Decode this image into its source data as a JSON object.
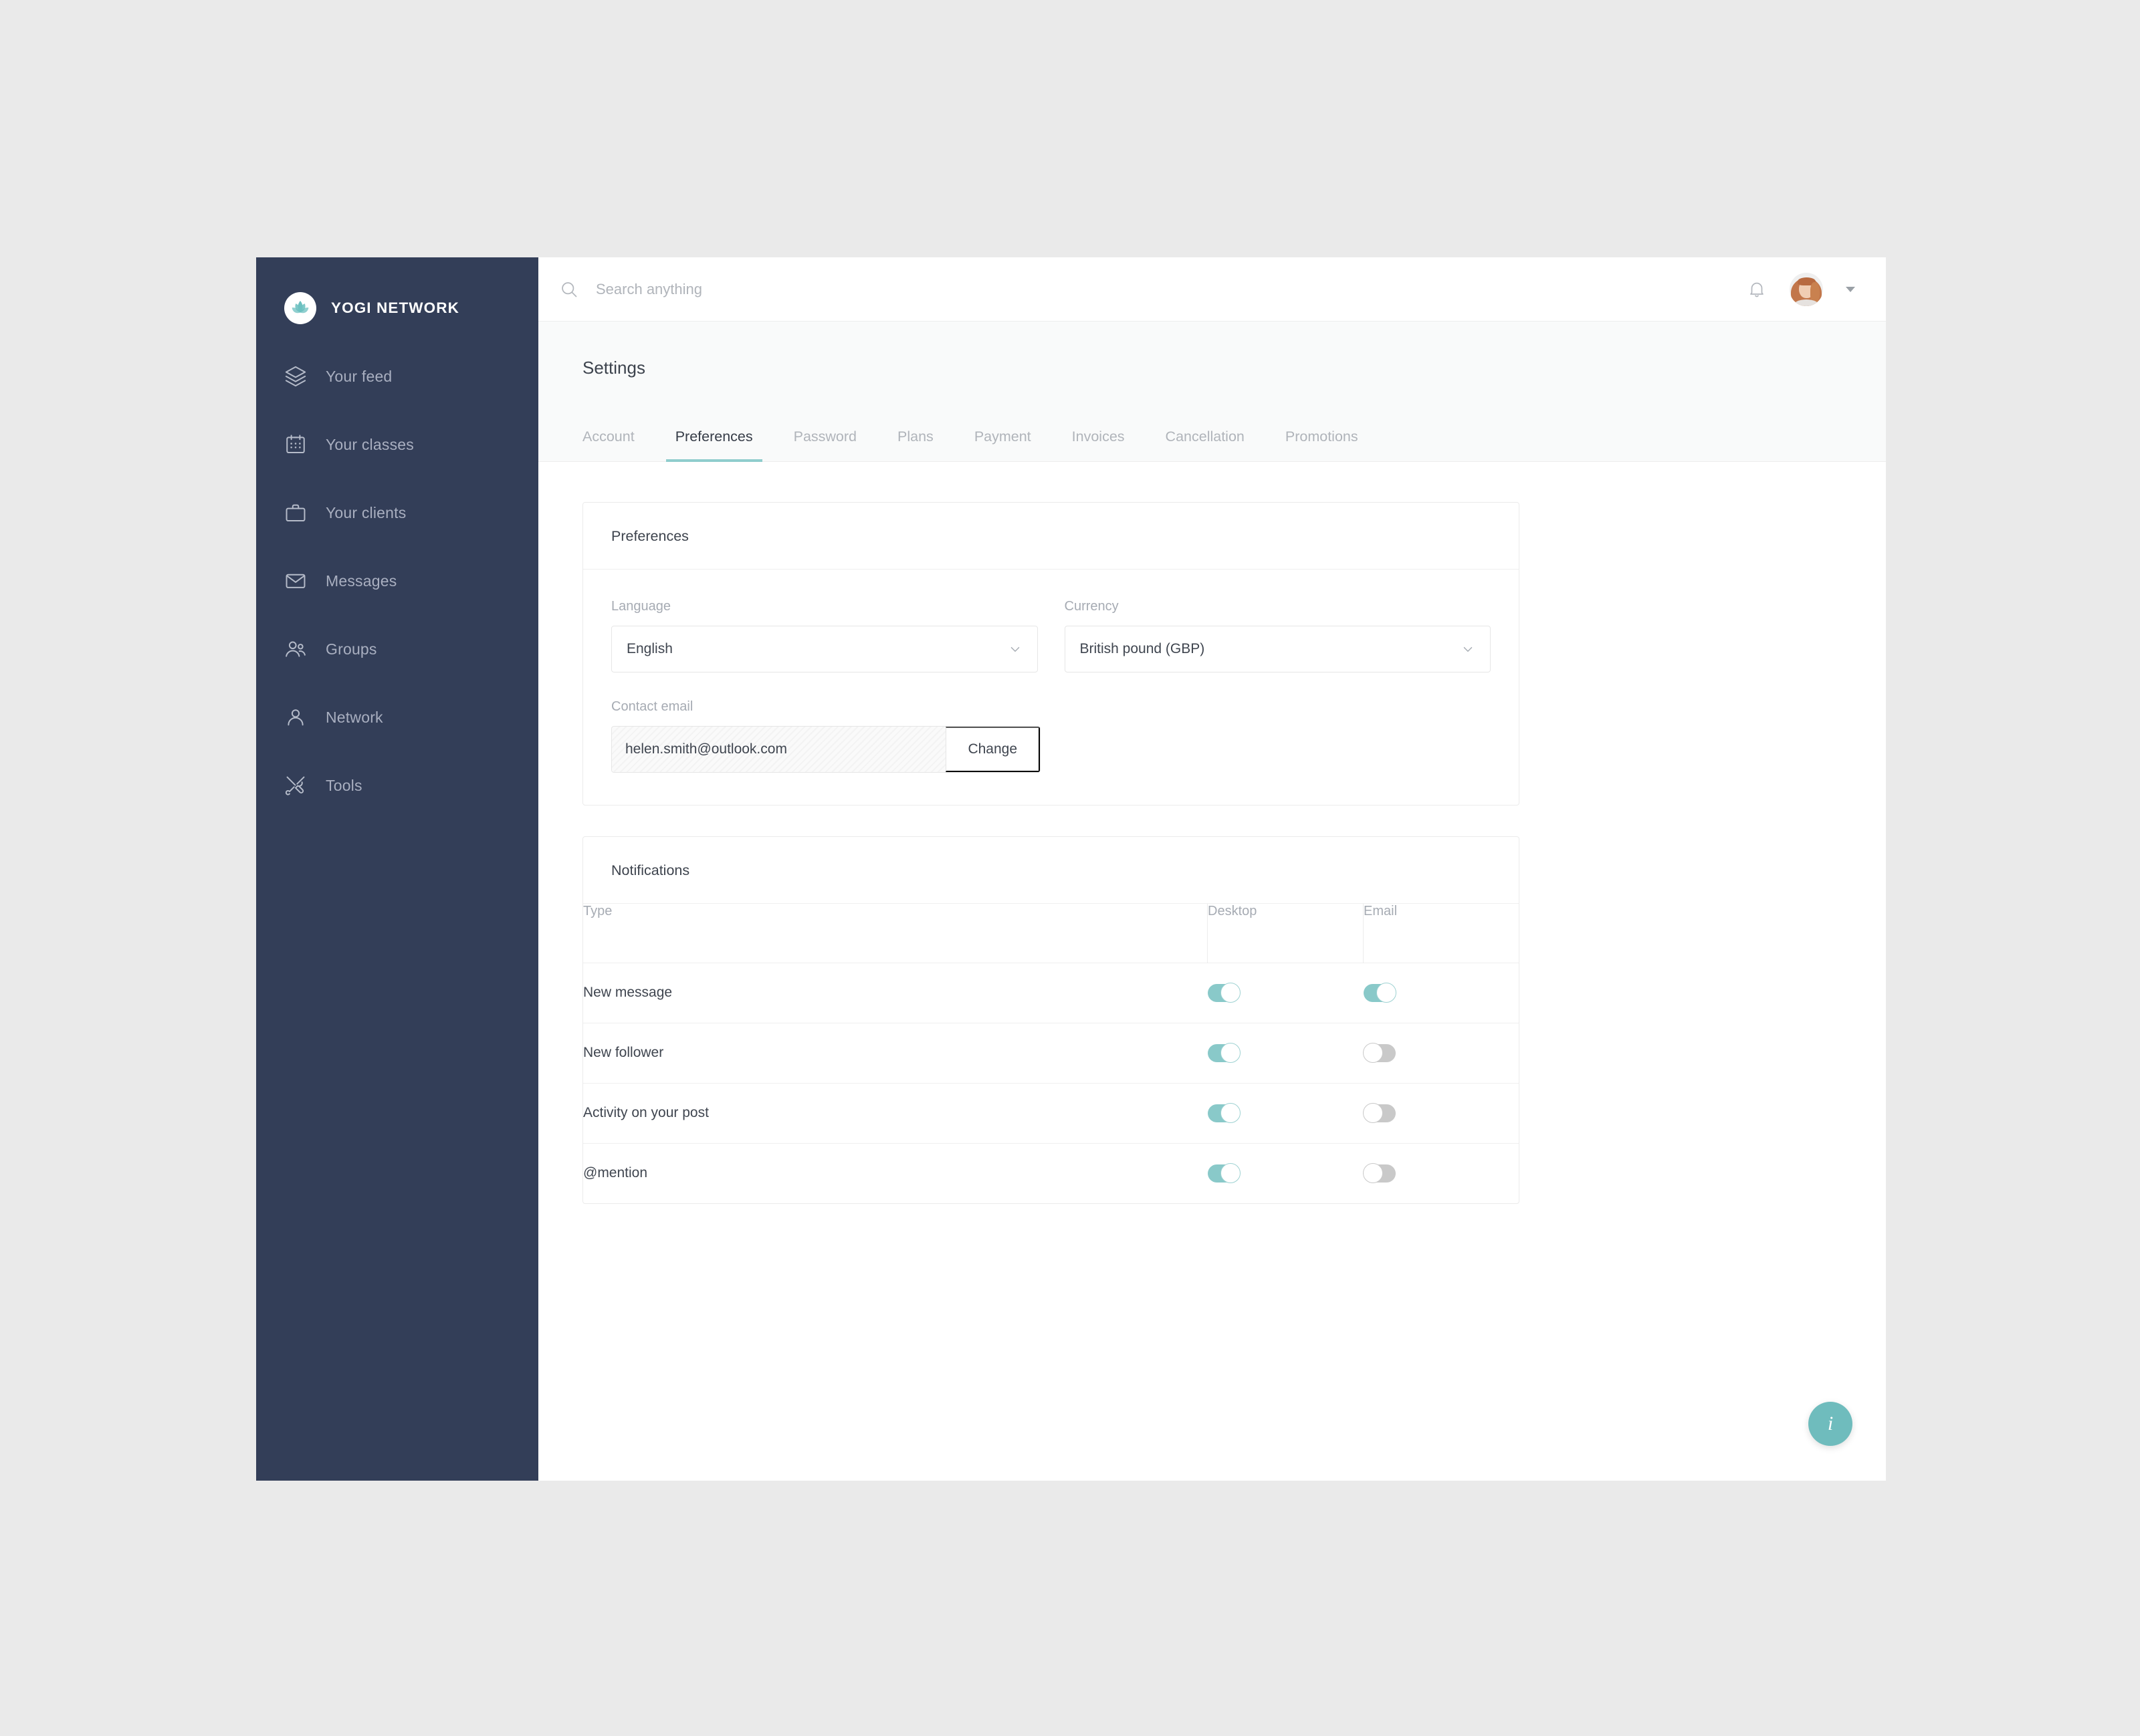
{
  "brand": {
    "name": "YOGI NETWORK",
    "logo_icon": "lotus-icon",
    "accent": "#7fc7c8"
  },
  "sidebar": {
    "items": [
      {
        "label": "Your feed",
        "icon": "layers-icon"
      },
      {
        "label": "Your classes",
        "icon": "calendar-icon"
      },
      {
        "label": "Your clients",
        "icon": "briefcase-icon"
      },
      {
        "label": "Messages",
        "icon": "envelope-icon"
      },
      {
        "label": "Groups",
        "icon": "users-icon"
      },
      {
        "label": "Network",
        "icon": "user-icon"
      },
      {
        "label": "Tools",
        "icon": "tools-icon"
      }
    ]
  },
  "topbar": {
    "search_placeholder": "Search anything",
    "search_value": "",
    "search_icon": "search-icon",
    "bell_icon": "bell-icon",
    "avatar": "user-avatar",
    "caret": "chevron-down-icon"
  },
  "page": {
    "title": "Settings",
    "tabs": [
      {
        "label": "Account",
        "active": false
      },
      {
        "label": "Preferences",
        "active": true
      },
      {
        "label": "Password",
        "active": false
      },
      {
        "label": "Plans",
        "active": false
      },
      {
        "label": "Payment",
        "active": false
      },
      {
        "label": "Invoices",
        "active": false
      },
      {
        "label": "Cancellation",
        "active": false
      },
      {
        "label": "Promotions",
        "active": false
      }
    ]
  },
  "preferences": {
    "card_title": "Preferences",
    "language_label": "Language",
    "language_value": "English",
    "currency_label": "Currency",
    "currency_value": "British pound (GBP)",
    "contact_email_label": "Contact email",
    "contact_email_value": "helen.smith@outlook.com",
    "change_label": "Change"
  },
  "notifications": {
    "card_title": "Notifications",
    "columns": [
      "Type",
      "Desktop",
      "Email"
    ],
    "rows": [
      {
        "type": "New message",
        "desktop": true,
        "email": true
      },
      {
        "type": "New follower",
        "desktop": true,
        "email": false
      },
      {
        "type": "Activity on your post",
        "desktop": true,
        "email": false
      },
      {
        "type": "@mention",
        "desktop": true,
        "email": false
      }
    ]
  },
  "fab": {
    "label": "i",
    "icon": "info-icon",
    "color": "#6fbcbd"
  }
}
